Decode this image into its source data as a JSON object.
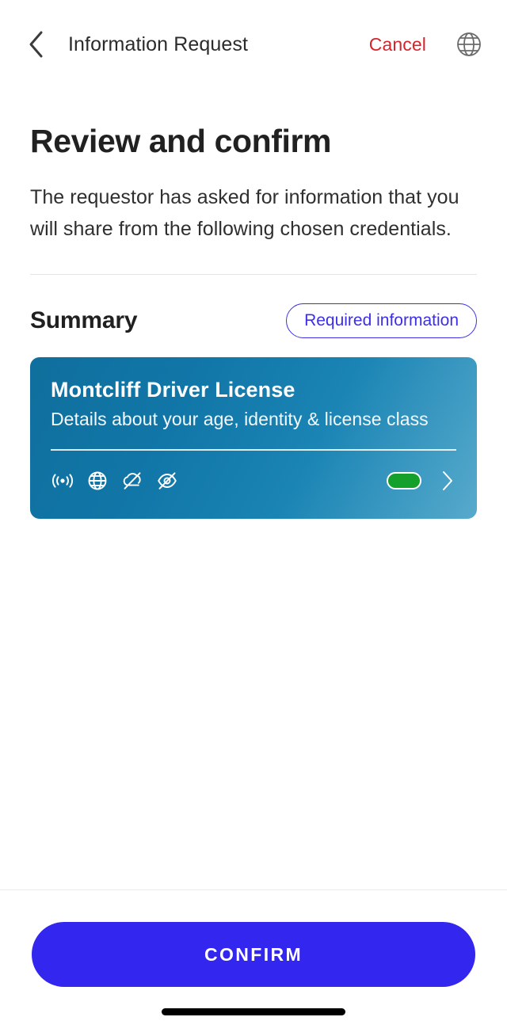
{
  "navbar": {
    "back_icon": "chevron-left-icon",
    "title": "Information Request",
    "cancel_label": "Cancel",
    "globe_icon": "globe-icon"
  },
  "main": {
    "page_title": "Review and confirm",
    "description": "The requestor has asked for information that you will share from the following chosen credentials.",
    "summary_label": "Summary",
    "required_badge": "Required information"
  },
  "credential_card": {
    "title": "Montcliff Driver License",
    "subtitle": "Details about your age, identity & license class",
    "icons": [
      "nfc-broadcast-icon",
      "globe-icon",
      "cloud-off-icon",
      "eye-off-icon"
    ],
    "status_pill": "status-on-pill",
    "chevron_icon": "chevron-right-icon",
    "colors": {
      "gradient_start": "#0f6f9d",
      "gradient_end": "#57aacc",
      "status_green": "#15a02c"
    }
  },
  "footer": {
    "confirm_label": "CONFIRM",
    "confirm_color": "#3326ee"
  },
  "system": {
    "home_indicator": "home-indicator"
  },
  "colors": {
    "accent_blue": "#3d2fe3",
    "cancel_red": "#d8232a"
  }
}
